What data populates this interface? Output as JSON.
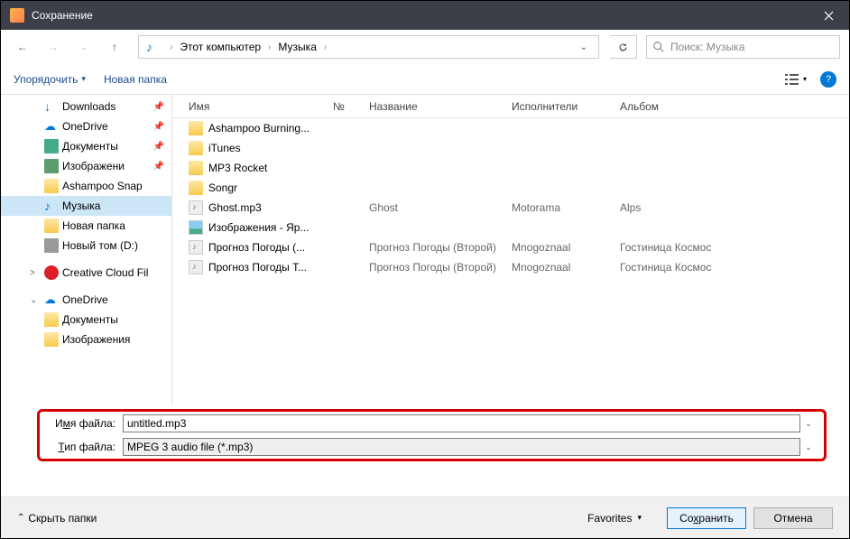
{
  "window": {
    "title": "Сохранение"
  },
  "nav": {
    "breadcrumb": [
      "Этот компьютер",
      "Музыка"
    ],
    "search_placeholder": "Поиск: Музыка"
  },
  "toolbar": {
    "organize": "Упорядочить",
    "new_folder": "Новая папка"
  },
  "sidebar": {
    "items": [
      {
        "label": "Downloads",
        "icon": "download",
        "indent": 1,
        "pin": true
      },
      {
        "label": "OneDrive",
        "icon": "onedrive",
        "indent": 1,
        "pin": true
      },
      {
        "label": "Документы",
        "icon": "doc",
        "indent": 1,
        "pin": true
      },
      {
        "label": "Изображени",
        "icon": "img",
        "indent": 1,
        "pin": true
      },
      {
        "label": "Ashampoo Snap",
        "icon": "folder",
        "indent": 1
      },
      {
        "label": "Музыка",
        "icon": "music",
        "indent": 1,
        "sel": true
      },
      {
        "label": "Новая папка",
        "icon": "folder",
        "indent": 1
      },
      {
        "label": "Новый том (D:)",
        "icon": "disk",
        "indent": 1
      },
      {
        "label": "Creative Cloud Fil",
        "icon": "cc",
        "indent": 2,
        "chev": ">"
      },
      {
        "label": "OneDrive",
        "icon": "onedrive",
        "indent": 2,
        "chev": "⌄"
      },
      {
        "label": "Документы",
        "icon": "folder",
        "indent": 1
      },
      {
        "label": "Изображения",
        "icon": "folder",
        "indent": 1
      }
    ]
  },
  "columns": {
    "name": "Имя",
    "num": "№",
    "title": "Название",
    "artist": "Исполнители",
    "album": "Альбом"
  },
  "files": [
    {
      "name": "Ashampoo Burning...",
      "type": "folder"
    },
    {
      "name": "iTunes",
      "type": "folder"
    },
    {
      "name": "MP3 Rocket",
      "type": "folder"
    },
    {
      "name": "Songr",
      "type": "folder"
    },
    {
      "name": "Ghost.mp3",
      "type": "mp3",
      "title": "Ghost",
      "artist": "Motorama",
      "album": "Alps"
    },
    {
      "name": "Изображения - Яр...",
      "type": "pic"
    },
    {
      "name": "Прогноз Погоды (...",
      "type": "mp3",
      "title": "Прогноз Погоды (Второй)",
      "artist": "Mnogoznaal",
      "album": "Гостиница Космос"
    },
    {
      "name": "Прогноз Погоды Т...",
      "type": "mp3",
      "title": "Прогноз Погоды (Второй)",
      "artist": "Mnogoznaal",
      "album": "Гостиница Космос"
    }
  ],
  "fields": {
    "filename_label_pre": "И",
    "filename_label_u": "м",
    "filename_label_post": "я файла:",
    "filetype_label_pre": "",
    "filetype_label_u": "Т",
    "filetype_label_post": "ип файла:",
    "filename_value": "untitled.mp3",
    "filetype_value": "MPEG 3 audio file (*.mp3)"
  },
  "footer": {
    "hide": "Скрыть папки",
    "favorites": "Favorites",
    "save_pre": "Со",
    "save_u": "х",
    "save_post": "ранить",
    "cancel": "Отмена"
  }
}
